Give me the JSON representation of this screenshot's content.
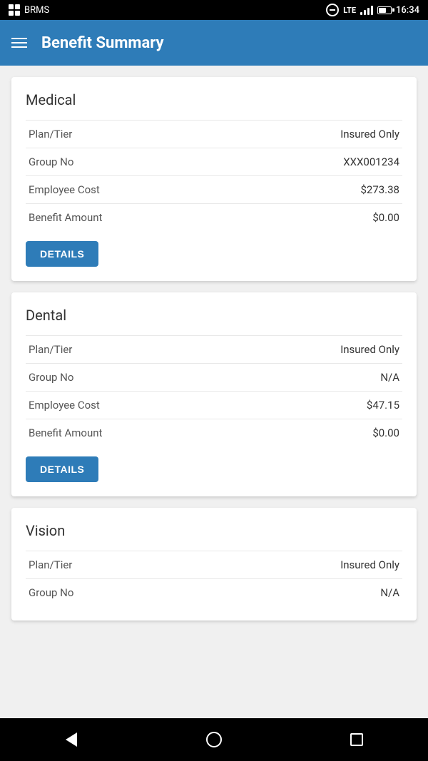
{
  "statusBar": {
    "appName": "BRMS",
    "time": "16:34",
    "lte": "LTE"
  },
  "appBar": {
    "title": "Benefit Summary",
    "menuIcon": "hamburger-icon"
  },
  "sections": [
    {
      "id": "medical",
      "title": "Medical",
      "rows": [
        {
          "label": "Plan/Tier",
          "value": "Insured Only"
        },
        {
          "label": "Group No",
          "value": "XXX001234"
        },
        {
          "label": "Employee Cost",
          "value": "$273.38"
        },
        {
          "label": "Benefit Amount",
          "value": "$0.00"
        }
      ],
      "detailsButton": "DETAILS"
    },
    {
      "id": "dental",
      "title": "Dental",
      "rows": [
        {
          "label": "Plan/Tier",
          "value": "Insured Only"
        },
        {
          "label": "Group No",
          "value": "N/A"
        },
        {
          "label": "Employee Cost",
          "value": "$47.15"
        },
        {
          "label": "Benefit Amount",
          "value": "$0.00"
        }
      ],
      "detailsButton": "DETAILS"
    },
    {
      "id": "vision",
      "title": "Vision",
      "rows": [
        {
          "label": "Plan/Tier",
          "value": "Insured Only"
        },
        {
          "label": "Group No",
          "value": "N/A"
        }
      ],
      "detailsButton": null
    }
  ],
  "bottomNav": {
    "back": "back",
    "home": "home",
    "recent": "recent"
  }
}
